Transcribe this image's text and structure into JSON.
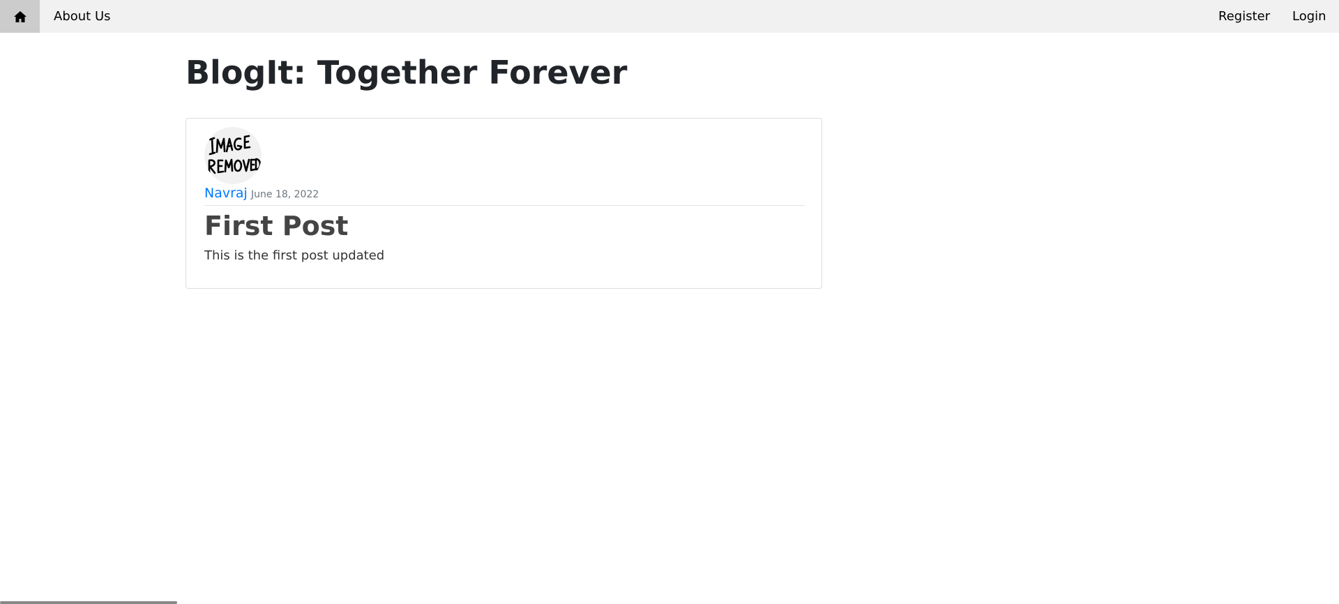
{
  "nav": {
    "home_icon": "home-icon",
    "about_label": "About Us",
    "register_label": "Register",
    "login_label": "Login"
  },
  "page": {
    "title": "BlogIt: Together Forever"
  },
  "post": {
    "avatar_alt": "IMAGE REMOVED",
    "author": "Navraj",
    "date": "June 18, 2022",
    "title": "First Post",
    "body": "This is the first post updated"
  },
  "colors": {
    "nav_bg": "#f1f1f1",
    "home_active_bg": "#cccccc",
    "link": "#007bff"
  }
}
